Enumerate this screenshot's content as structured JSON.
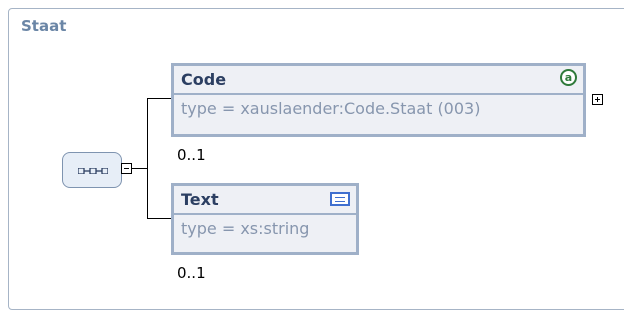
{
  "diagram": {
    "title": "Staat",
    "root": {
      "kind": "sequence",
      "icon": "sequence-icon",
      "collapsed": false
    },
    "elements": [
      {
        "name": "Code",
        "type": "type = xauslaender:Code.Staat (003)",
        "cardinality": "0..1",
        "has_attributes": true,
        "attribute_icon": "attribute-icon",
        "attribute_glyph": "a",
        "expandable": true
      },
      {
        "name": "Text",
        "type": "type = xs:string",
        "cardinality": "0..1",
        "has_documentation": true,
        "documentation_icon": "documentation-icon",
        "expandable": false
      }
    ],
    "colors": {
      "title": "#6b86a6",
      "box_border": "#9fb0c8",
      "box_fill": "#eef0f5",
      "name_text": "#2c3f62",
      "type_text": "#8796ae",
      "attribute_icon": "#2f7a3a",
      "documentation_icon": "#3f6fcf"
    }
  }
}
